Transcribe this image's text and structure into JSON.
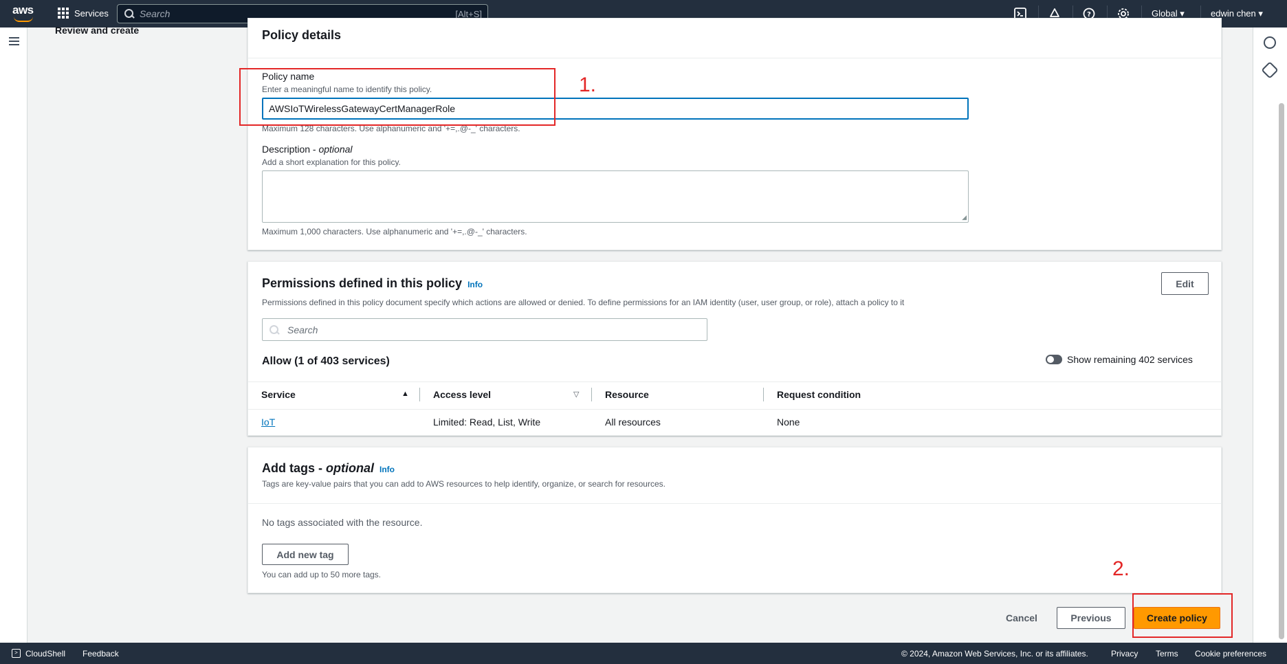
{
  "topnav": {
    "logo_text": "aws",
    "services_label": "Services",
    "search_placeholder": "Search",
    "search_shortcut": "[Alt+S]",
    "region": "Global ▾",
    "user": "edwin chen ▾"
  },
  "sidebar": {
    "partial_step": "Review and create"
  },
  "policy_details": {
    "title": "Policy details",
    "name_label": "Policy name",
    "name_hint": "Enter a meaningful name to identify this policy.",
    "name_value": "AWSIoTWirelessGatewayCertManagerRole",
    "name_constraint": "Maximum 128 characters. Use alphanumeric and '+=,.@-_' characters.",
    "desc_label": "Description - ",
    "desc_label_optional": "optional",
    "desc_hint": "Add a short explanation for this policy.",
    "desc_value": "",
    "desc_constraint": "Maximum 1,000 characters. Use alphanumeric and '+=,.@-_' characters."
  },
  "permissions": {
    "title": "Permissions defined in this policy",
    "info": "Info",
    "edit_label": "Edit",
    "description": "Permissions defined in this policy document specify which actions are allowed or denied. To define permissions for an IAM identity (user, user group, or role), attach a policy to it",
    "search_placeholder": "Search",
    "allow_summary": "Allow (1 of 403 services)",
    "toggle_label": "Show remaining 402 services",
    "columns": [
      "Service",
      "Access level",
      "Resource",
      "Request condition"
    ],
    "rows": [
      {
        "service": "IoT",
        "access_level": "Limited: Read, List, Write",
        "resource": "All resources",
        "condition": "None"
      }
    ]
  },
  "tags": {
    "title": "Add tags - ",
    "title_optional": "optional",
    "info": "Info",
    "description": "Tags are key-value pairs that you can add to AWS resources to help identify, organize, or search for resources.",
    "empty_text": "No tags associated with the resource.",
    "add_label": "Add new tag",
    "limit_hint": "You can add up to 50 more tags."
  },
  "actions": {
    "cancel": "Cancel",
    "previous": "Previous",
    "create": "Create policy"
  },
  "annotations": {
    "step1": "1.",
    "step2": "2."
  },
  "footer": {
    "cloudshell": "CloudShell",
    "feedback": "Feedback",
    "copyright": "© 2024, Amazon Web Services, Inc. or its affiliates.",
    "privacy": "Privacy",
    "terms": "Terms",
    "cookies": "Cookie preferences"
  },
  "colors": {
    "nav_bg": "#232f3e",
    "primary": "#ff9900",
    "link": "#0073bb",
    "annotation": "#e32626"
  }
}
